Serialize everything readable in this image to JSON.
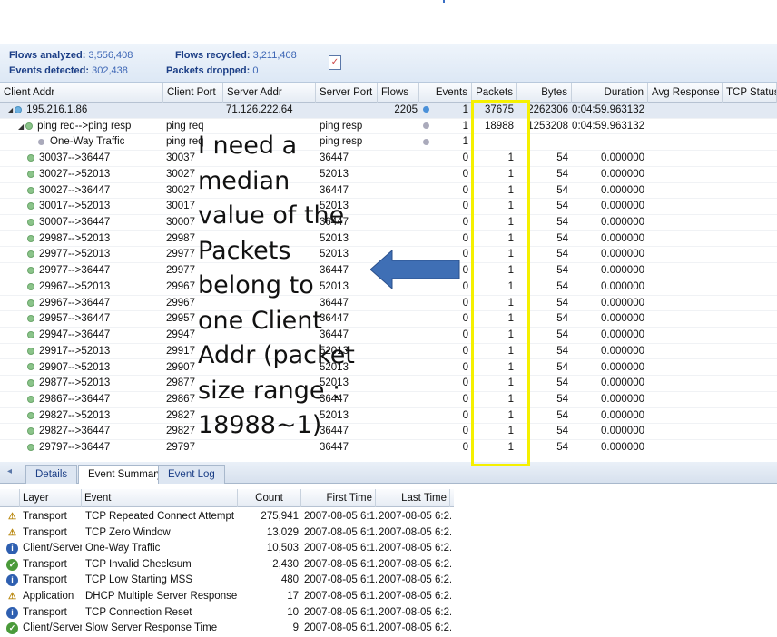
{
  "stats": {
    "flows_analyzed_label": "Flows analyzed:",
    "flows_analyzed_value": "3,556,408",
    "events_detected_label": "Events detected:",
    "events_detected_value": "302,438",
    "flows_recycled_label": "Flows recycled:",
    "flows_recycled_value": "3,211,408",
    "packets_dropped_label": "Packets dropped:",
    "packets_dropped_value": "0"
  },
  "columns": [
    "Client Addr",
    "Client Port",
    "Server Addr",
    "Server Port",
    "Flows",
    "Events",
    "Packets",
    "Bytes",
    "Duration",
    "Avg Response ...",
    "TCP Status"
  ],
  "rows": [
    {
      "client": "195.216.1.86",
      "cport": "",
      "saddr": "71.126.222.64",
      "sport": "",
      "flows": "2205",
      "events": "1",
      "packets": "37675",
      "bytes": "2262306",
      "duration": "0:04:59.963132"
    },
    {
      "client": "ping req-->ping resp",
      "cport": "ping req",
      "saddr": "",
      "sport": "ping resp",
      "flows": "",
      "events": "1",
      "packets": "18988",
      "bytes": "1253208",
      "duration": "0:04:59.963132"
    },
    {
      "client": "One-Way Traffic",
      "cport": "ping req",
      "saddr": "",
      "sport": "ping resp",
      "flows": "",
      "events": "1",
      "packets": "",
      "bytes": "",
      "duration": ""
    },
    {
      "client": "30037-->36447",
      "cport": "30037",
      "saddr": "",
      "sport": "36447",
      "flows": "",
      "events": "0",
      "packets": "1",
      "bytes": "54",
      "duration": "0.000000"
    },
    {
      "client": "30027-->52013",
      "cport": "30027",
      "saddr": "",
      "sport": "52013",
      "flows": "",
      "events": "0",
      "packets": "1",
      "bytes": "54",
      "duration": "0.000000"
    },
    {
      "client": "30027-->36447",
      "cport": "30027",
      "saddr": "",
      "sport": "36447",
      "flows": "",
      "events": "0",
      "packets": "1",
      "bytes": "54",
      "duration": "0.000000"
    },
    {
      "client": "30017-->52013",
      "cport": "30017",
      "saddr": "",
      "sport": "52013",
      "flows": "",
      "events": "0",
      "packets": "1",
      "bytes": "54",
      "duration": "0.000000"
    },
    {
      "client": "30007-->36447",
      "cport": "30007",
      "saddr": "",
      "sport": "36447",
      "flows": "",
      "events": "0",
      "packets": "1",
      "bytes": "54",
      "duration": "0.000000"
    },
    {
      "client": "29987-->52013",
      "cport": "29987",
      "saddr": "",
      "sport": "52013",
      "flows": "",
      "events": "0",
      "packets": "1",
      "bytes": "54",
      "duration": "0.000000"
    },
    {
      "client": "29977-->52013",
      "cport": "29977",
      "saddr": "",
      "sport": "52013",
      "flows": "",
      "events": "0",
      "packets": "1",
      "bytes": "54",
      "duration": "0.000000"
    },
    {
      "client": "29977-->36447",
      "cport": "29977",
      "saddr": "",
      "sport": "36447",
      "flows": "",
      "events": "0",
      "packets": "1",
      "bytes": "54",
      "duration": "0.000000"
    },
    {
      "client": "29967-->52013",
      "cport": "29967",
      "saddr": "",
      "sport": "52013",
      "flows": "",
      "events": "0",
      "packets": "1",
      "bytes": "54",
      "duration": "0.000000"
    },
    {
      "client": "29967-->36447",
      "cport": "29967",
      "saddr": "",
      "sport": "36447",
      "flows": "",
      "events": "0",
      "packets": "1",
      "bytes": "54",
      "duration": "0.000000"
    },
    {
      "client": "29957-->36447",
      "cport": "29957",
      "saddr": "",
      "sport": "36447",
      "flows": "",
      "events": "0",
      "packets": "1",
      "bytes": "54",
      "duration": "0.000000"
    },
    {
      "client": "29947-->36447",
      "cport": "29947",
      "saddr": "",
      "sport": "36447",
      "flows": "",
      "events": "0",
      "packets": "1",
      "bytes": "54",
      "duration": "0.000000"
    },
    {
      "client": "29917-->52013",
      "cport": "29917",
      "saddr": "",
      "sport": "52013",
      "flows": "",
      "events": "0",
      "packets": "1",
      "bytes": "54",
      "duration": "0.000000"
    },
    {
      "client": "29907-->52013",
      "cport": "29907",
      "saddr": "",
      "sport": "52013",
      "flows": "",
      "events": "0",
      "packets": "1",
      "bytes": "54",
      "duration": "0.000000"
    },
    {
      "client": "29877-->52013",
      "cport": "29877",
      "saddr": "",
      "sport": "52013",
      "flows": "",
      "events": "0",
      "packets": "1",
      "bytes": "54",
      "duration": "0.000000"
    },
    {
      "client": "29867-->36447",
      "cport": "29867",
      "saddr": "",
      "sport": "36447",
      "flows": "",
      "events": "0",
      "packets": "1",
      "bytes": "54",
      "duration": "0.000000"
    },
    {
      "client": "29827-->52013",
      "cport": "29827",
      "saddr": "",
      "sport": "52013",
      "flows": "",
      "events": "0",
      "packets": "1",
      "bytes": "54",
      "duration": "0.000000"
    },
    {
      "client": "29827-->36447",
      "cport": "29827",
      "saddr": "",
      "sport": "36447",
      "flows": "",
      "events": "0",
      "packets": "1",
      "bytes": "54",
      "duration": "0.000000"
    },
    {
      "client": "29797-->36447",
      "cport": "29797",
      "saddr": "",
      "sport": "36447",
      "flows": "",
      "events": "0",
      "packets": "1",
      "bytes": "54",
      "duration": "0.000000"
    }
  ],
  "tabs": [
    "Details",
    "Event Summary",
    "Event Log"
  ],
  "event_columns": [
    "Layer",
    "Event",
    "Count",
    "First Time",
    "Last Time"
  ],
  "events": [
    {
      "icon": "warning",
      "layer": "Transport",
      "event": "TCP Repeated Connect Attempt",
      "count": "275,941",
      "first": "2007-08-05 6:1...",
      "last": "2007-08-05 6:2..."
    },
    {
      "icon": "warning",
      "layer": "Transport",
      "event": "TCP Zero Window",
      "count": "13,029",
      "first": "2007-08-05 6:1...",
      "last": "2007-08-05 6:2..."
    },
    {
      "icon": "info",
      "layer": "Client/Server",
      "event": "One-Way Traffic",
      "count": "10,503",
      "first": "2007-08-05 6:1...",
      "last": "2007-08-05 6:2..."
    },
    {
      "icon": "ok",
      "layer": "Transport",
      "event": "TCP Invalid Checksum",
      "count": "2,430",
      "first": "2007-08-05 6:1...",
      "last": "2007-08-05 6:2..."
    },
    {
      "icon": "info",
      "layer": "Transport",
      "event": "TCP Low Starting MSS",
      "count": "480",
      "first": "2007-08-05 6:1...",
      "last": "2007-08-05 6:2..."
    },
    {
      "icon": "warning",
      "layer": "Application",
      "event": "DHCP Multiple Server Response",
      "count": "17",
      "first": "2007-08-05 6:1...",
      "last": "2007-08-05 6:2..."
    },
    {
      "icon": "info",
      "layer": "Transport",
      "event": "TCP Connection Reset",
      "count": "10",
      "first": "2007-08-05 6:1...",
      "last": "2007-08-05 6:2..."
    },
    {
      "icon": "ok",
      "layer": "Client/Server",
      "event": "Slow Server Response Time",
      "count": "9",
      "first": "2007-08-05 6:1...",
      "last": "2007-08-05 6:2..."
    }
  ],
  "annotation": {
    "text": "I need a\nmedian\nvalue of the\nPackets\nbelong to\none Client\nAddr (packet\nsize range :\n18988~1)",
    "highlight_color": "#f5f000",
    "arrow_color": "#3f6fb5"
  }
}
